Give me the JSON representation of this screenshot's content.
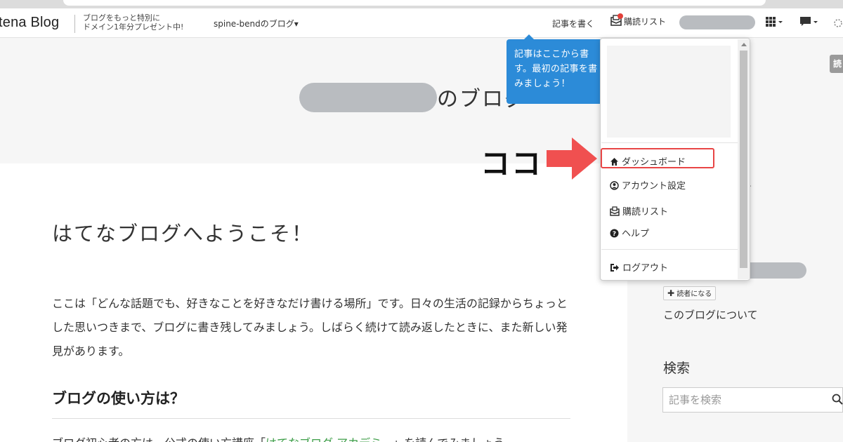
{
  "header": {
    "logo_text": "tena Blog",
    "promo_line1": "ブログをもっと特別に",
    "promo_line2": "ドメイン1年分プレゼント中!",
    "blog_selector": "spine-bendのブログ▾",
    "write_label": "記事を書く",
    "reader_label": "購読リスト",
    "grid_icon": "grid-menu-icon",
    "message_icon": "message-icon"
  },
  "blog": {
    "title_suffix": "のブログ"
  },
  "tooltip": {
    "line1": "記事はここから書",
    "line2": "す。最初の記事を書",
    "line3": "みましょう！"
  },
  "dropdown": {
    "items": [
      {
        "label": "ダッシュボード",
        "icon": "home-icon"
      },
      {
        "label": "アカウント設定",
        "icon": "user-circle-icon"
      },
      {
        "label": "購読リスト",
        "icon": "mail-reader-icon"
      },
      {
        "label": "ヘルプ",
        "icon": "question-icon"
      },
      {
        "label": "ログアウト",
        "icon": "logout-icon"
      }
    ]
  },
  "annotation": {
    "label": "ココ",
    "color": "#f05050"
  },
  "post": {
    "title": "はてなブログへようこそ！",
    "body": "ここは「どんな話題でも、好きなことを好きなだけ書ける場所」です。日々の生活の記録からちょっとした思いつきまで、ブログに書き残してみましょう。しばらく続けて読み返したときに、また新しい発見があります。",
    "section_heading": "ブログの使い方は？",
    "cut_line_prefix": "ブログ初心者の方は、公式の使い方講座「",
    "cut_line_link": "はてなブログ アカデミー",
    "cut_line_suffix": "」を読んでみましょう"
  },
  "sidebar": {
    "subscribe_label": "読者になる",
    "about_link": "このブログについて",
    "search_heading": "検索",
    "search_placeholder": "記事を検索",
    "edge_button": "読"
  },
  "colors": {
    "tooltip_bg": "#2c8bd8",
    "highlight": "#e84545",
    "link": "#3c9d47"
  }
}
